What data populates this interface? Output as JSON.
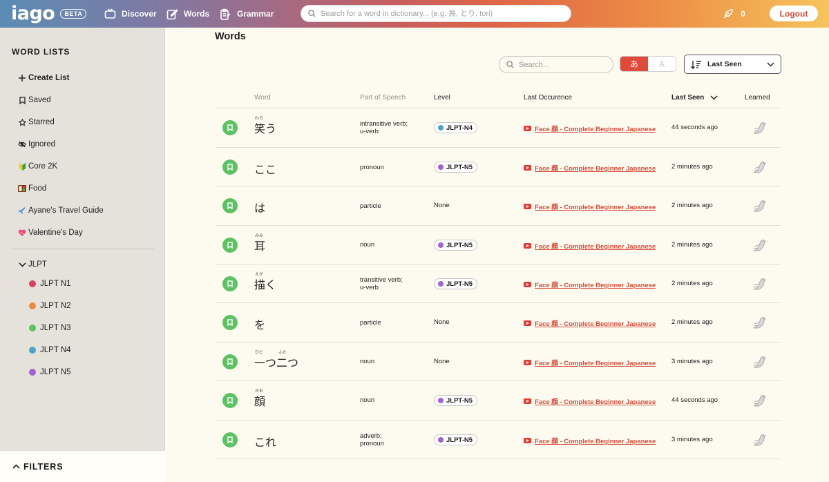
{
  "app": {
    "logo": "iago",
    "beta": "BETA",
    "nav": {
      "discover": "Discover",
      "words": "Words",
      "grammar": "Grammar"
    },
    "search_placeholder": "Search for a word in dictionary... (e.g. 鳥, とり, tori)",
    "points": "0",
    "logout": "Logout"
  },
  "sidebar": {
    "title": "WORD LISTS",
    "create": "Create List",
    "items": [
      {
        "label": "Saved",
        "icon": "bookmark-icon"
      },
      {
        "label": "Starred",
        "icon": "star-icon"
      },
      {
        "label": "Ignored",
        "icon": "eye-off-icon"
      },
      {
        "label": "Core 2K",
        "icon": "beginner-leaf-icon"
      },
      {
        "label": "Food",
        "icon": "bento-icon"
      },
      {
        "label": "Ayane's Travel Guide",
        "icon": "airplane-icon"
      },
      {
        "label": "Valentine's Day",
        "icon": "heart-ribbon-icon"
      }
    ],
    "jlpt_group": "JLPT",
    "jlpt_items": [
      {
        "label": "JLPT N1",
        "color": "#d9415a"
      },
      {
        "label": "JLPT N2",
        "color": "#ee8a3a"
      },
      {
        "label": "JLPT N3",
        "color": "#5cc262"
      },
      {
        "label": "JLPT N4",
        "color": "#4ba3c9"
      },
      {
        "label": "JLPT N5",
        "color": "#a461d8"
      }
    ],
    "filters": "FILTERS"
  },
  "main": {
    "title": "Words",
    "search_placeholder": "Search...",
    "toggle_kana": "あ",
    "toggle_latin": "A",
    "sort_label": "Last Seen",
    "columns": {
      "word": "Word",
      "pos": "Part of Speech",
      "level": "Level",
      "occurrence": "Last Occurence",
      "seen": "Last Seen",
      "learned": "Learned"
    },
    "rows": [
      {
        "word": "笑う",
        "furigana": "わら",
        "pos1": "intransitive verb;",
        "pos2": "u-verb",
        "level": "JLPT-N4",
        "level_color": "#4ba3c9",
        "occurrence": "Face 顔 - Complete Beginner Japanese",
        "seen": "44 seconds ago"
      },
      {
        "word": "ここ",
        "furigana": "",
        "pos1": "pronoun",
        "pos2": "",
        "level": "JLPT-N5",
        "level_color": "#a461d8",
        "occurrence": "Face 顔 - Complete Beginner Japanese",
        "seen": "2 minutes ago"
      },
      {
        "word": "は",
        "furigana": "",
        "pos1": "particle",
        "pos2": "",
        "level": "None",
        "level_color": "",
        "occurrence": "Face 顔 - Complete Beginner Japanese",
        "seen": "2 minutes ago"
      },
      {
        "word": "耳",
        "furigana": "みみ",
        "pos1": "noun",
        "pos2": "",
        "level": "JLPT-N5",
        "level_color": "#a461d8",
        "occurrence": "Face 顔 - Complete Beginner Japanese",
        "seen": "2 minutes ago"
      },
      {
        "word": "描く",
        "furigana": "えが",
        "pos1": "transitive verb;",
        "pos2": "u-verb",
        "level": "JLPT-N5",
        "level_color": "#a461d8",
        "occurrence": "Face 顔 - Complete Beginner Japanese",
        "seen": "2 minutes ago"
      },
      {
        "word": "を",
        "furigana": "",
        "pos1": "particle",
        "pos2": "",
        "level": "None",
        "level_color": "",
        "occurrence": "Face 顔 - Complete Beginner Japanese",
        "seen": "2 minutes ago"
      },
      {
        "word": "一つ二つ",
        "furigana": "ひと",
        "furigana2": "ふた",
        "pos1": "noun",
        "pos2": "",
        "level": "None",
        "level_color": "",
        "occurrence": "Face 顔 - Complete Beginner Japanese",
        "seen": "3 minutes ago"
      },
      {
        "word": "顔",
        "furigana": "かお",
        "pos1": "noun",
        "pos2": "",
        "level": "JLPT-N5",
        "level_color": "#a461d8",
        "occurrence": "Face 顔 - Complete Beginner Japanese",
        "seen": "44 seconds ago"
      },
      {
        "word": "これ",
        "furigana": "",
        "pos1": "adverb;",
        "pos2": "pronoun",
        "level": "JLPT-N5",
        "level_color": "#a461d8",
        "occurrence": "Face 顔 - Complete Beginner Japanese",
        "seen": "3 minutes ago"
      }
    ]
  }
}
